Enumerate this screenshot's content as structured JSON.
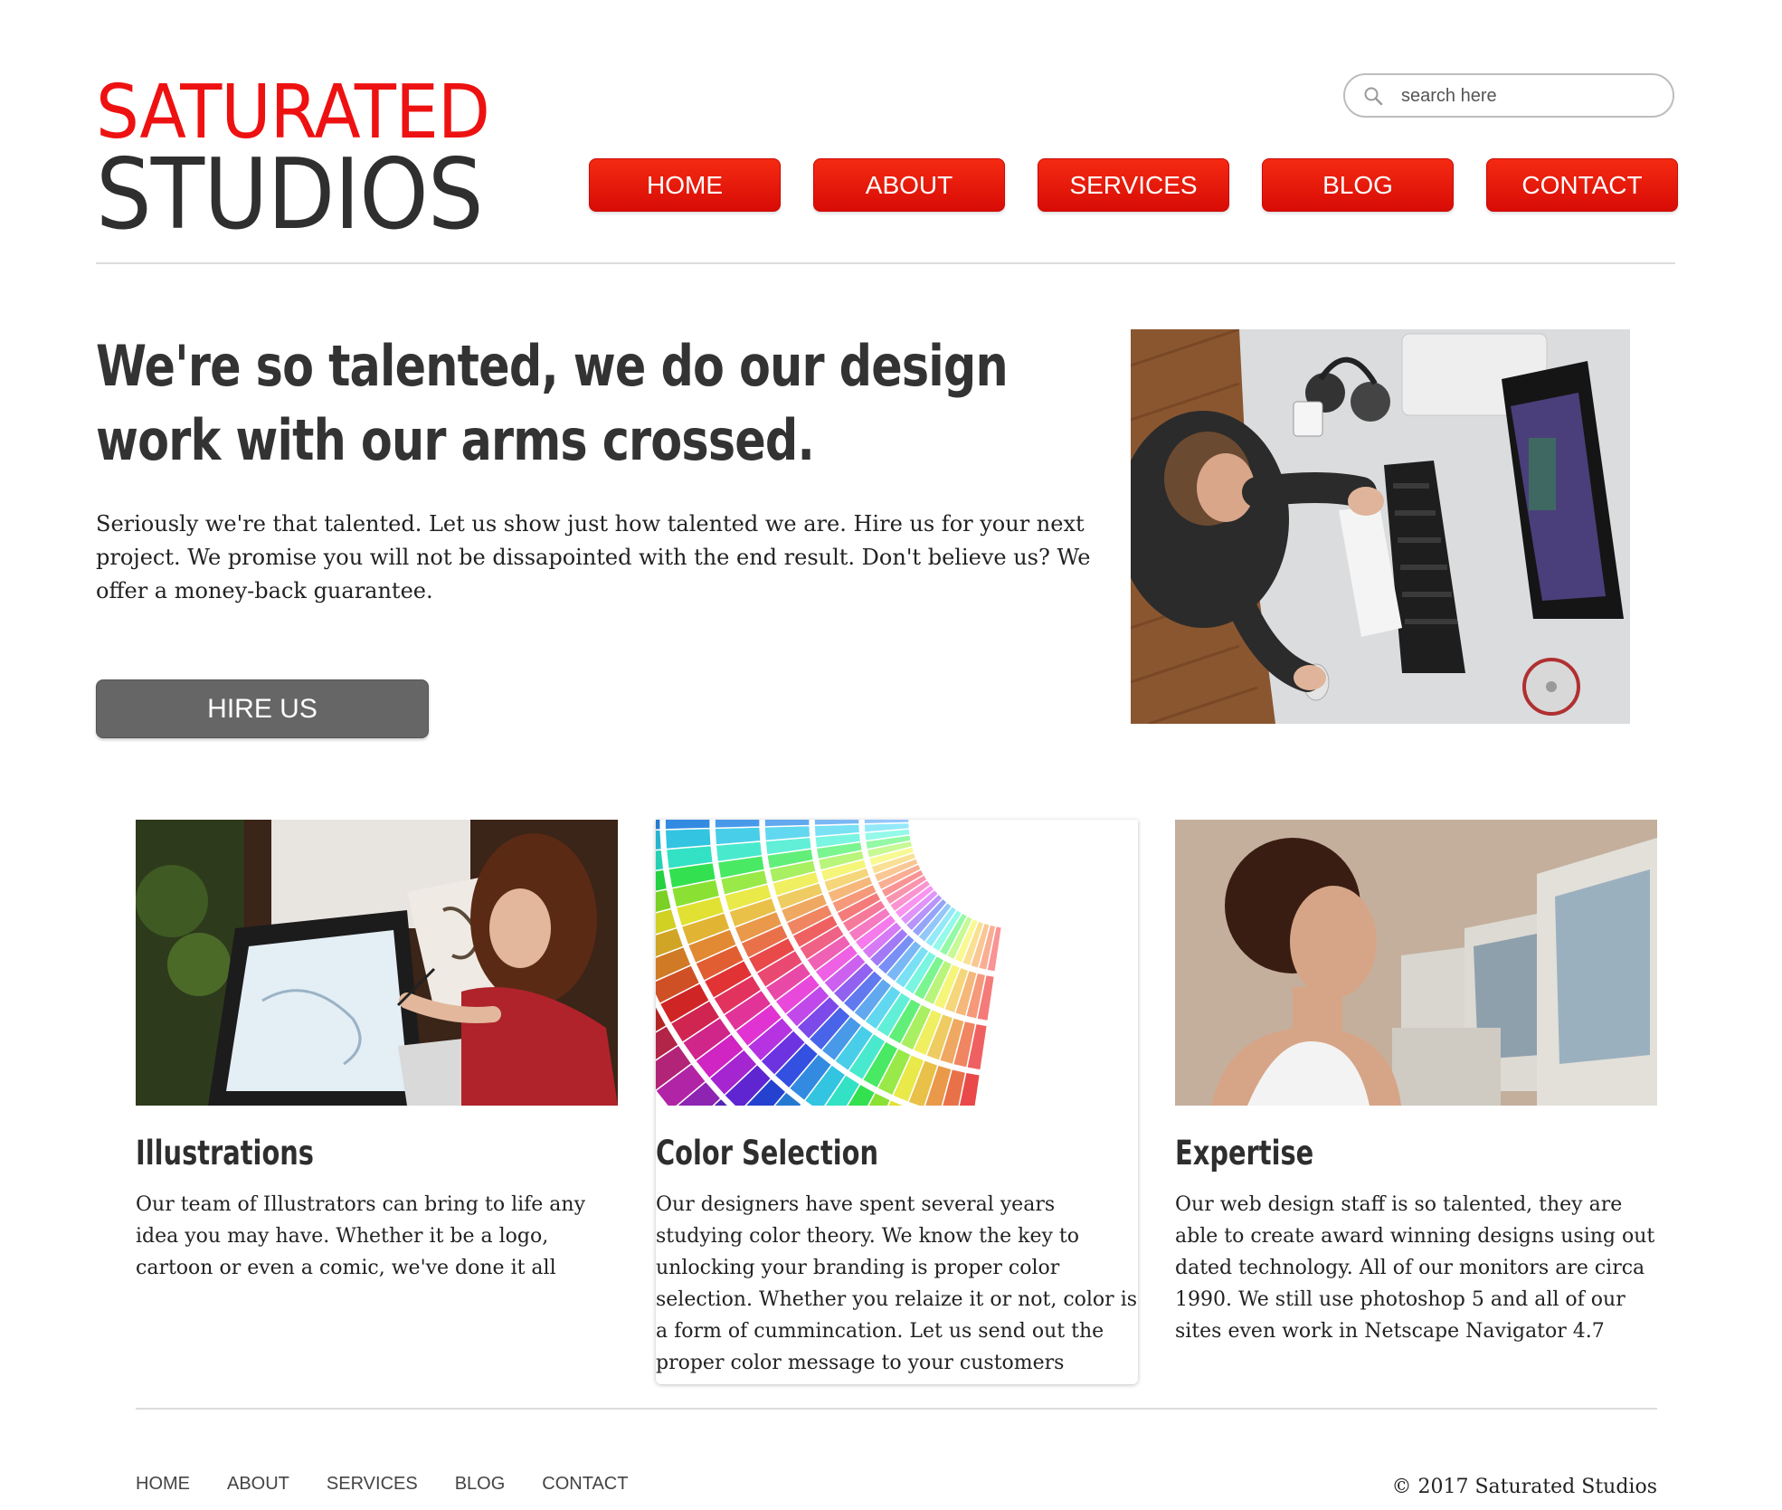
{
  "brand": {
    "line1": "SATURATED",
    "line2": "STUDIOS",
    "accent_color": "#ee1111"
  },
  "search": {
    "placeholder": "search here",
    "icon": "search-icon"
  },
  "nav": {
    "items": [
      {
        "label": "HOME"
      },
      {
        "label": "ABOUT"
      },
      {
        "label": "SERVICES"
      },
      {
        "label": "BLOG"
      },
      {
        "label": "CONTACT"
      }
    ],
    "button_color": "#e01508"
  },
  "hero": {
    "title": "We're so talented, we do our design work with our arms crossed.",
    "text": "Seriously we're that talented. Let us show just how talented we are. Hire us for your next project. We promise you will not be dissapointed with the end result. Don't believe us? We offer a money-back guarantee.",
    "button_label": "HIRE US",
    "button_color": "#666666"
  },
  "features": [
    {
      "title": "Illustrations",
      "text": "Our team of Illustrators can bring to life any idea you may have. Whether it be a logo, cartoon or even a comic, we've done it all"
    },
    {
      "title": "Color Selection",
      "text": "Our designers have spent several years studying color theory. We know the key to unlocking your branding is proper color selection. Whether you relaize it or not, color is a form of cummincation. Let us send out the proper color message to your customers"
    },
    {
      "title": "Expertise",
      "text": "Our web design staff is so talented, they are able to create award winning designs using out dated technology. All of our monitors are circa 1990. We still use photoshop 5 and all of our sites even work in Netscape Navigator 4.7"
    }
  ],
  "footer": {
    "links": [
      {
        "label": "HOME"
      },
      {
        "label": "ABOUT"
      },
      {
        "label": "SERVICES"
      },
      {
        "label": "BLOG"
      },
      {
        "label": "CONTACT"
      }
    ],
    "copyright": "© 2017 Saturated Studios"
  }
}
